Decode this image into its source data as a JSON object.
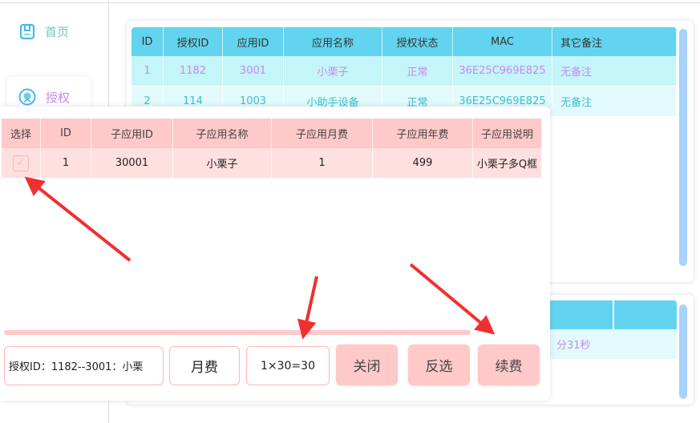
{
  "sidebar": {
    "items": [
      {
        "label": "首页",
        "icon": "save-icon"
      },
      {
        "label": "授权",
        "icon": "badge-icon",
        "active": true
      }
    ]
  },
  "auth_table": {
    "columns": [
      "ID",
      "授权ID",
      "应用ID",
      "应用名称",
      "授权状态",
      "MAC",
      "其它备注"
    ],
    "rows": [
      [
        "1",
        "1182",
        "3001",
        "小栗子",
        "正常",
        "36E25C969E825",
        "无备注"
      ],
      [
        "2",
        "114",
        "1003",
        "小助手设备",
        "正常",
        "36E25C969E825",
        "无备注"
      ]
    ]
  },
  "second_table": {
    "partial_text": "分31秒"
  },
  "popup": {
    "columns": [
      "选择",
      "ID",
      "子应用ID",
      "子应用名称",
      "子应用月费",
      "子应用年费",
      "子应用说明"
    ],
    "rows": [
      {
        "checked": true,
        "cells": [
          "1",
          "30001",
          "小栗子",
          "1",
          "499",
          "小栗子多Q框"
        ]
      }
    ],
    "info_field": "授权ID：1182--3001：小栗",
    "period": "月费",
    "calc_field": "1×30=30",
    "buttons": {
      "close": "关闭",
      "invert": "反选",
      "renew": "续费"
    }
  },
  "colors": {
    "header_cyan": "#62d4ef",
    "header_pink": "#ffc9c9",
    "arrow": "#f03030"
  }
}
